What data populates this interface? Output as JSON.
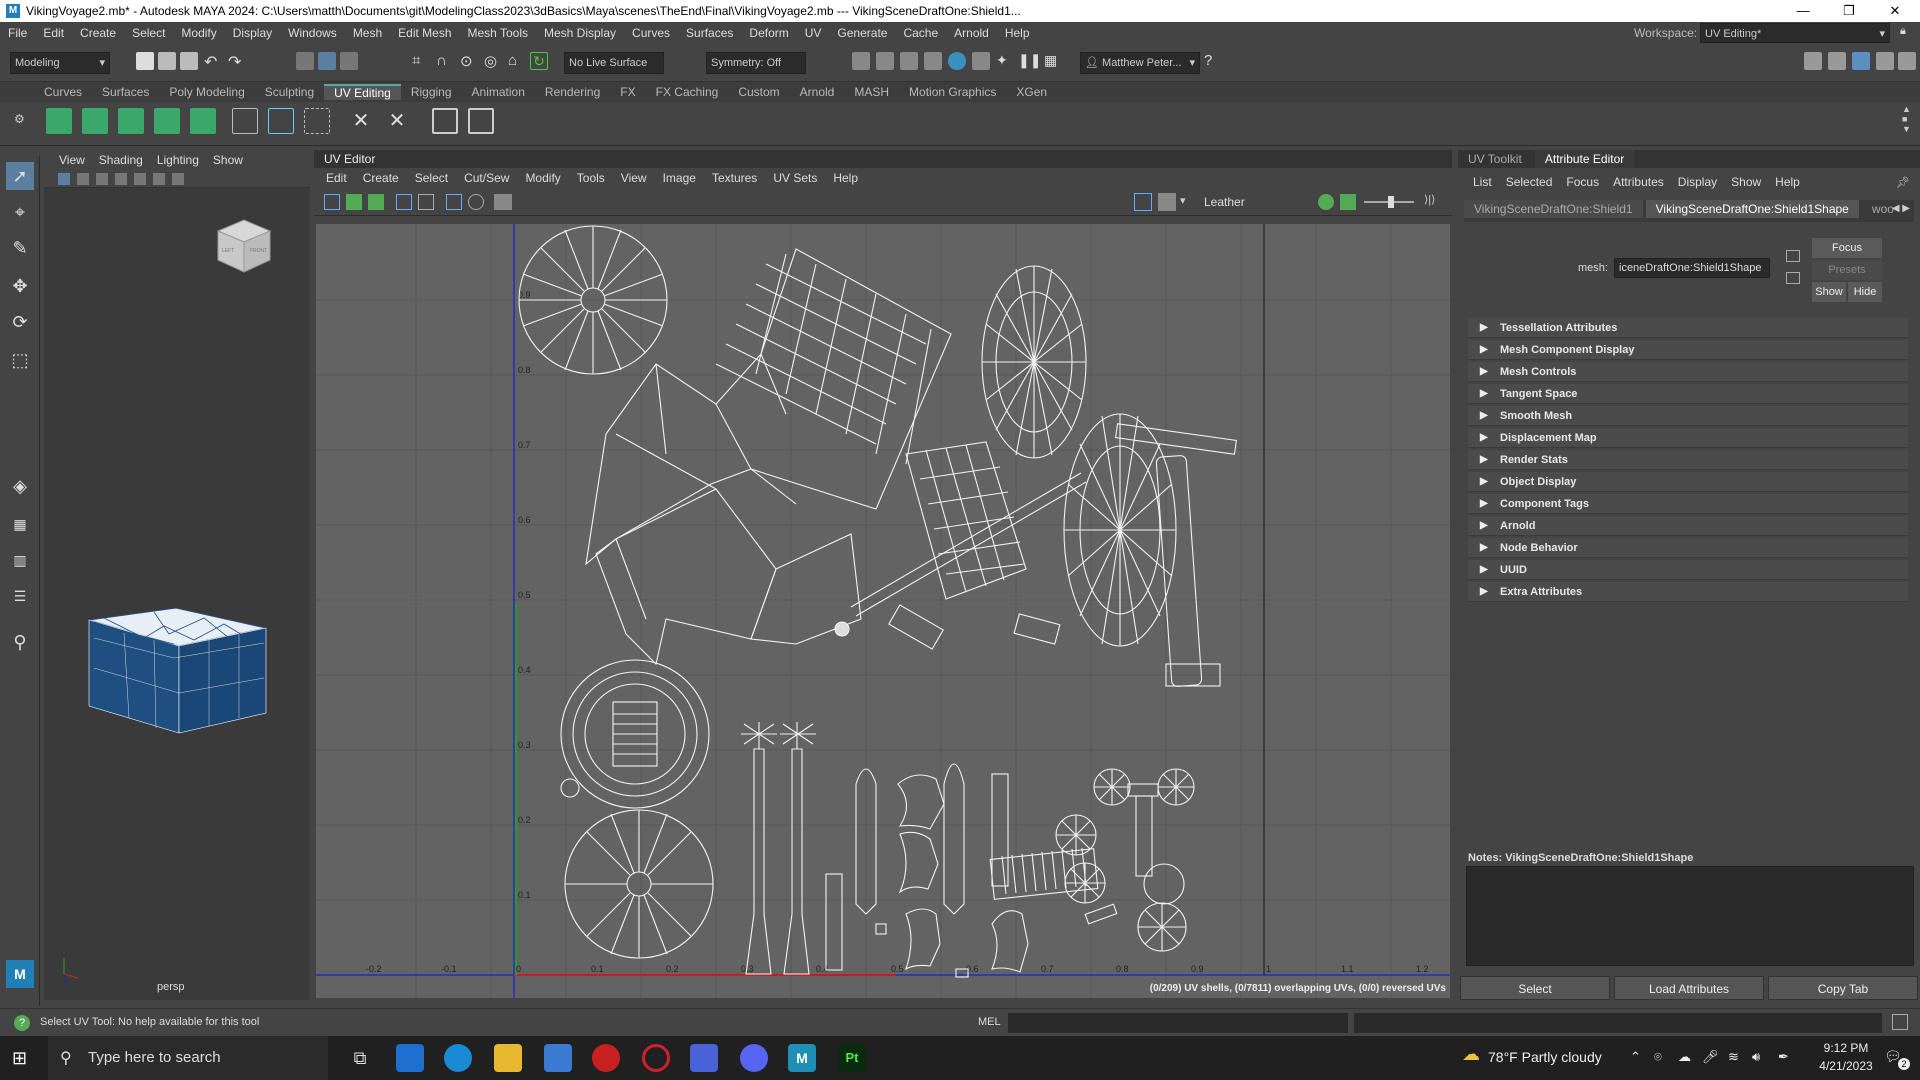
{
  "titlebar": {
    "text": "VikingVoyage2.mb* - Autodesk MAYA 2024: C:\\Users\\matth\\Documents\\git\\ModelingClass2023\\3dBasics\\Maya\\scenes\\TheEnd\\Final\\VikingVoyage2.mb  ---  VikingSceneDraftOne:Shield1..."
  },
  "menubar": {
    "items": [
      "File",
      "Edit",
      "Create",
      "Select",
      "Modify",
      "Display",
      "Windows",
      "Mesh",
      "Edit Mesh",
      "Mesh Tools",
      "Mesh Display",
      "Curves",
      "Surfaces",
      "Deform",
      "UV",
      "Generate",
      "Cache",
      "Arnold",
      "Help"
    ],
    "workspace_label": "Workspace:",
    "workspace_value": "UV Editing*"
  },
  "toolbar": {
    "mode": "Modeling",
    "live_surface": "No Live Surface",
    "symmetry": "Symmetry: Off",
    "user": "Matthew Peter..."
  },
  "shelf": {
    "tabs": [
      "Curves",
      "Surfaces",
      "Poly Modeling",
      "Sculpting",
      "UV Editing",
      "Rigging",
      "Animation",
      "Rendering",
      "FX",
      "FX Caching",
      "Custom",
      "Arnold",
      "MASH",
      "Motion Graphics",
      "XGen"
    ],
    "active_tab": "UV Editing"
  },
  "viewport": {
    "menu": [
      "View",
      "Shading",
      "Lighting",
      "Show"
    ],
    "camera_label": "persp",
    "viewcube_labels": [
      "LEFT",
      "FRONT"
    ],
    "colors": {
      "mesh": "#1f4f80",
      "wire": "#ffffff"
    }
  },
  "uv_editor": {
    "title": "UV Editor",
    "menu": [
      "Edit",
      "Create",
      "Select",
      "Cut/Sew",
      "Modify",
      "Tools",
      "View",
      "Image",
      "Textures",
      "UV Sets",
      "Help"
    ],
    "texture_name": "Leather",
    "status": "(0/209) UV shells, (0/7811) overlapping UVs, (0/0) reversed UVs",
    "axis_x_labels": [
      "-0.2",
      "-0.1",
      "0",
      "0.1",
      "0.2",
      "0.3",
      "0.4",
      "0.5",
      "0.6",
      "0.7",
      "0.8",
      "0.9",
      "1",
      "1.1",
      "1.2"
    ],
    "axis_y_labels": [
      "0.1",
      "0.2",
      "0.3",
      "0.4",
      "0.5",
      "0.6",
      "0.7",
      "0.8",
      "0.9"
    ],
    "colors": {
      "bg": "#636363",
      "wire": "#f2f2f2",
      "u_axis": "#c02020",
      "v_axis": "#20a020",
      "border": "#2030c0"
    }
  },
  "right_panel": {
    "tabs": [
      "UV Toolkit",
      "Attribute Editor"
    ],
    "active_tab": "Attribute Editor",
    "menu": [
      "List",
      "Selected",
      "Focus",
      "Attributes",
      "Display",
      "Show",
      "Help"
    ],
    "node_tabs": [
      "VikingSceneDraftOne:Shield1",
      "VikingSceneDraftOne:Shield1Shape",
      "woo"
    ],
    "mesh_label": "mesh:",
    "mesh_value": "iceneDraftOne:Shield1Shape",
    "buttons": {
      "focus": "Focus",
      "presets": "Presets",
      "show": "Show",
      "hide": "Hide"
    },
    "sections": [
      "Tessellation Attributes",
      "Mesh Component Display",
      "Mesh Controls",
      "Tangent Space",
      "Smooth Mesh",
      "Displacement Map",
      "Render Stats",
      "Object Display",
      "Component Tags",
      "Arnold",
      "Node Behavior",
      "UUID",
      "Extra Attributes"
    ],
    "notes": "Notes:  VikingSceneDraftOne:Shield1Shape",
    "bottom_buttons": [
      "Select",
      "Load Attributes",
      "Copy Tab"
    ]
  },
  "statusline": {
    "help": "Select UV Tool: No help available for this tool",
    "mel": "MEL"
  },
  "taskbar": {
    "search_placeholder": "Type here to search",
    "weather": "78°F  Partly cloudy",
    "time": "9:12 PM",
    "date": "4/21/2023",
    "notifications": "2"
  }
}
